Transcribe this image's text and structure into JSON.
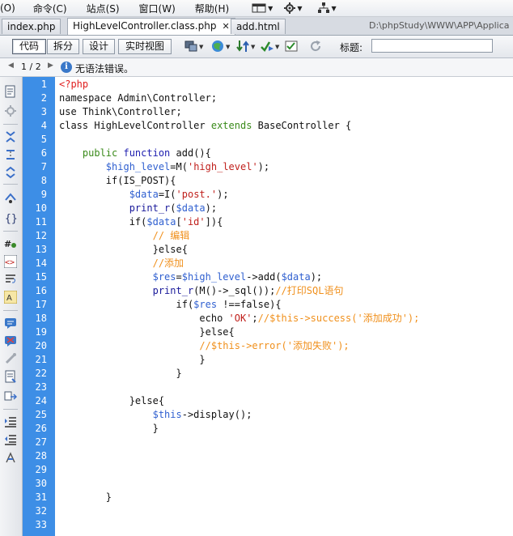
{
  "menubar": {
    "items": [
      "(O)",
      "命令(C)",
      "站点(S)",
      "窗口(W)",
      "帮助(H)"
    ]
  },
  "tabs": [
    {
      "label": "index.php",
      "active": false
    },
    {
      "label": "HighLevelController.class.php",
      "active": true
    },
    {
      "label": "add.html",
      "active": false
    }
  ],
  "path": "D:\\phpStudy\\WWW\\APP\\Applica",
  "toolbar": {
    "view_buttons": [
      "代码",
      "拆分",
      "设计",
      "实时视图"
    ],
    "title_label": "标题:",
    "title_value": ""
  },
  "infobar": {
    "pages": "1 / 2",
    "message": "无语法错误。"
  },
  "line_numbers": [
    "1",
    "2",
    "3",
    "4",
    "5",
    "6",
    "7",
    "8",
    "9",
    "10",
    "11",
    "12",
    "13",
    "14",
    "15",
    "16",
    "17",
    "18",
    "19",
    "20",
    "21",
    "22",
    "23",
    "24",
    "25",
    "26",
    "27",
    "28",
    "29",
    "30",
    "31",
    "32",
    "33"
  ],
  "code_lines": [
    [
      {
        "t": "<?php",
        "c": "php"
      }
    ],
    [
      {
        "t": "namespace Admin\\Controller;",
        "c": "plain"
      }
    ],
    [
      {
        "t": "use Think\\Controller;",
        "c": "plain"
      }
    ],
    [
      {
        "t": "class ",
        "c": "plain"
      },
      {
        "t": "HighLevelController ",
        "c": "plain"
      },
      {
        "t": "extends ",
        "c": "green"
      },
      {
        "t": "BaseController {",
        "c": "plain"
      }
    ],
    [],
    [
      {
        "t": "    public ",
        "c": "green"
      },
      {
        "t": "function ",
        "c": "kw"
      },
      {
        "t": "add(){",
        "c": "plain"
      }
    ],
    [
      {
        "t": "        ",
        "c": "plain"
      },
      {
        "t": "$high_level",
        "c": "var"
      },
      {
        "t": "=M(",
        "c": "plain"
      },
      {
        "t": "'high_level'",
        "c": "str"
      },
      {
        "t": ");",
        "c": "plain"
      }
    ],
    [
      {
        "t": "        if(IS_POST){",
        "c": "plain"
      }
    ],
    [
      {
        "t": "            ",
        "c": "plain"
      },
      {
        "t": "$data",
        "c": "var"
      },
      {
        "t": "=I(",
        "c": "plain"
      },
      {
        "t": "'post.'",
        "c": "str"
      },
      {
        "t": ");",
        "c": "plain"
      }
    ],
    [
      {
        "t": "            ",
        "c": "plain"
      },
      {
        "t": "print_r",
        "c": "fn"
      },
      {
        "t": "(",
        "c": "plain"
      },
      {
        "t": "$data",
        "c": "var"
      },
      {
        "t": ");",
        "c": "plain"
      }
    ],
    [
      {
        "t": "            if(",
        "c": "plain"
      },
      {
        "t": "$data",
        "c": "var"
      },
      {
        "t": "[",
        "c": "plain"
      },
      {
        "t": "'id'",
        "c": "str"
      },
      {
        "t": "]){",
        "c": "plain"
      }
    ],
    [
      {
        "t": "                // 编辑",
        "c": "cmt"
      }
    ],
    [
      {
        "t": "                }else{",
        "c": "plain"
      }
    ],
    [
      {
        "t": "                //添加",
        "c": "cmt"
      }
    ],
    [
      {
        "t": "                ",
        "c": "plain"
      },
      {
        "t": "$res",
        "c": "var"
      },
      {
        "t": "=",
        "c": "plain"
      },
      {
        "t": "$high_level",
        "c": "var"
      },
      {
        "t": "->add(",
        "c": "plain"
      },
      {
        "t": "$data",
        "c": "var"
      },
      {
        "t": ");",
        "c": "plain"
      }
    ],
    [
      {
        "t": "                ",
        "c": "plain"
      },
      {
        "t": "print_r",
        "c": "fn"
      },
      {
        "t": "(M()->_sql());",
        "c": "plain"
      },
      {
        "t": "//打印SQL语句",
        "c": "cmt"
      }
    ],
    [
      {
        "t": "                    if(",
        "c": "plain"
      },
      {
        "t": "$res",
        "c": "var"
      },
      {
        "t": " !==false){",
        "c": "plain"
      }
    ],
    [
      {
        "t": "                        echo ",
        "c": "plain"
      },
      {
        "t": "'OK'",
        "c": "str"
      },
      {
        "t": ";",
        "c": "plain"
      },
      {
        "t": "//$this->success('添加成功');",
        "c": "cmt"
      }
    ],
    [
      {
        "t": "                        }else{",
        "c": "plain"
      }
    ],
    [
      {
        "t": "                        //$this->error('添加失败');",
        "c": "cmt"
      }
    ],
    [
      {
        "t": "                        }",
        "c": "plain"
      }
    ],
    [
      {
        "t": "                    }",
        "c": "plain"
      }
    ],
    [],
    [
      {
        "t": "            }else{",
        "c": "plain"
      }
    ],
    [
      {
        "t": "                ",
        "c": "plain"
      },
      {
        "t": "$this",
        "c": "var"
      },
      {
        "t": "->display();",
        "c": "plain"
      }
    ],
    [
      {
        "t": "                }",
        "c": "plain"
      }
    ],
    [],
    [],
    [],
    [],
    [
      {
        "t": "        }",
        "c": "plain"
      }
    ],
    [],
    []
  ]
}
